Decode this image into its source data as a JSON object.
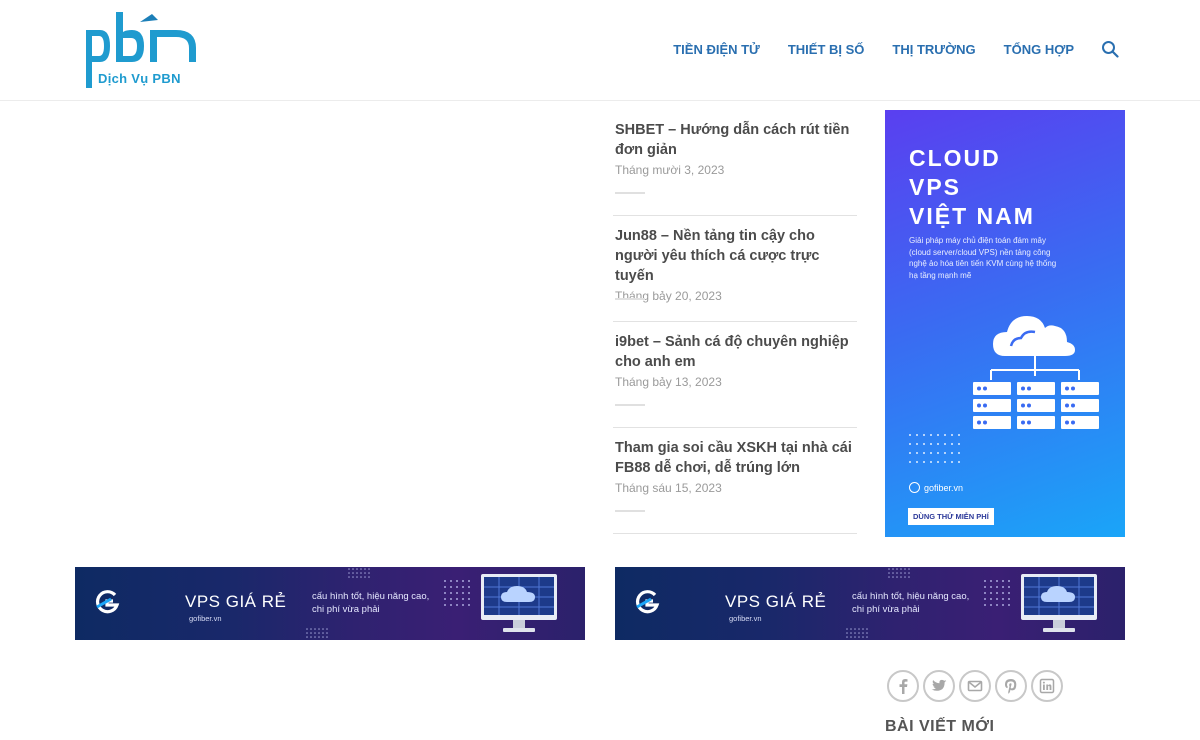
{
  "header": {
    "logo_text": "pbn",
    "logo_sub": "Dịch Vụ PBN",
    "nav": [
      {
        "label": "TIỀN ĐIỆN TỬ"
      },
      {
        "label": "THIẾT BỊ SỐ"
      },
      {
        "label": "THỊ TRƯỜNG"
      },
      {
        "label": "TỔNG HỢP"
      }
    ],
    "search_icon": "search-icon"
  },
  "posts": [
    {
      "title": "SHBET – Hướng dẫn cách rút tiền đơn giản",
      "date": "Tháng mười 3, 2023"
    },
    {
      "title": "Jun88 – Nền tảng tin cậy cho người yêu thích cá cược trực tuyến",
      "date": "Tháng bảy 20, 2023"
    },
    {
      "title": "i9bet – Sảnh cá độ chuyên nghiệp cho anh em",
      "date": "Tháng bảy 13, 2023"
    },
    {
      "title": "Tham gia soi cầu XSKH tại nhà cái FB88 dễ chơi, dễ trúng lớn",
      "date": "Tháng sáu 15, 2023"
    }
  ],
  "tall_ad": {
    "title_lines": [
      "CLOUD",
      "VPS",
      "VIỆT NAM"
    ],
    "description": "Giải pháp máy chủ điện toán đám mây (cloud server/cloud VPS) nền tảng công nghệ ảo hóa tiên tiến KVM cùng hệ thống hạ tầng mạnh mẽ",
    "site": "gofiber.vn",
    "cta": "DÙNG THỬ MIỄN PHÍ"
  },
  "banners": [
    {
      "title": "VPS GIÁ RẺ",
      "site": "gofiber.vn",
      "tagline": "cấu hình tốt, hiệu năng cao, chi phí vừa phải"
    },
    {
      "title": "VPS GIÁ RẺ",
      "site": "gofiber.vn",
      "tagline": "cấu hình tốt, hiệu năng cao, chi phí vừa phải"
    }
  ],
  "share_icons": [
    "facebook-icon",
    "twitter-icon",
    "email-icon",
    "pinterest-icon",
    "linkedin-icon"
  ],
  "sidebar": {
    "heading": "BÀI VIẾT MỚI"
  },
  "colors": {
    "nav": "#2a6fb0",
    "logo": "#1f9bcf",
    "post_title": "#4b4b4b",
    "post_date": "#9a9a9a"
  }
}
